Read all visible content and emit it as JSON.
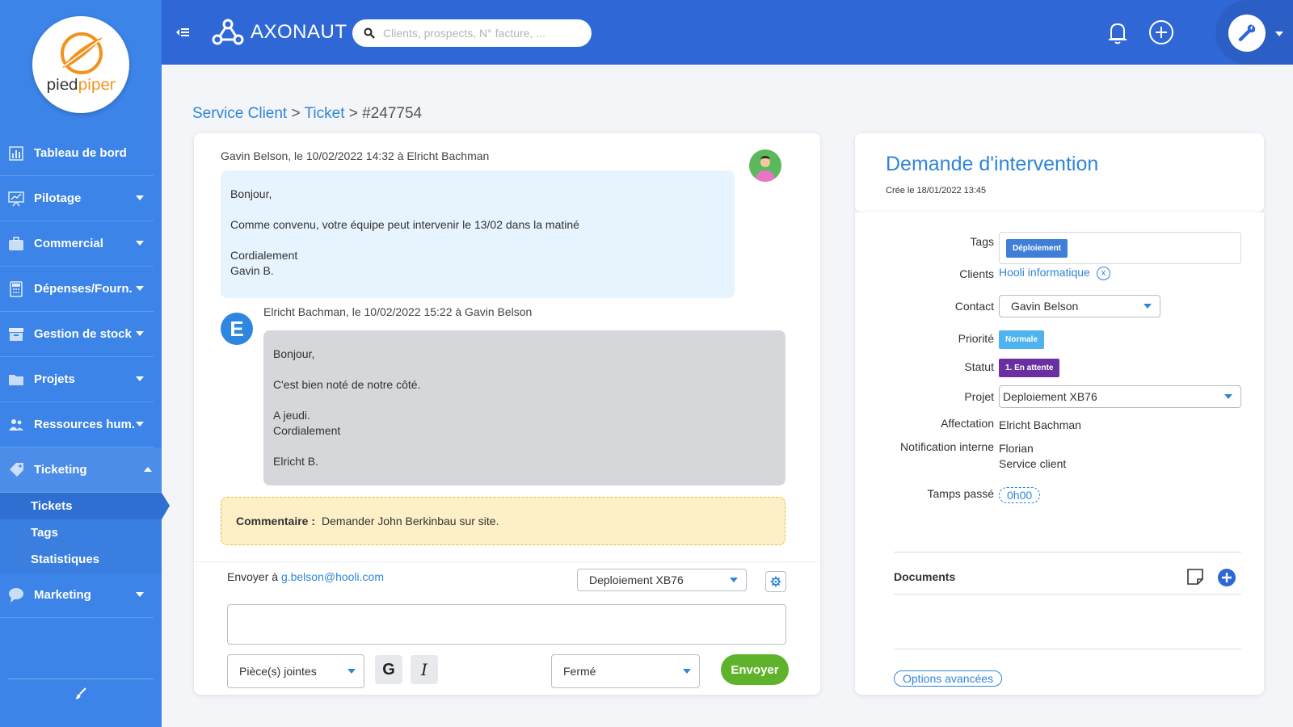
{
  "sidebar": {
    "logo": {
      "text_a": "pied",
      "text_b": "piper"
    },
    "items": [
      {
        "label": "Tableau de bord"
      },
      {
        "label": "Pilotage"
      },
      {
        "label": "Commercial"
      },
      {
        "label": "Dépenses/Fourn."
      },
      {
        "label": "Gestion de stock"
      },
      {
        "label": "Projets"
      },
      {
        "label": "Ressources hum."
      },
      {
        "label": "Ticketing"
      },
      {
        "label": "Marketing"
      }
    ],
    "ticketing_sub": [
      {
        "label": "Tickets"
      },
      {
        "label": "Tags"
      },
      {
        "label": "Statistiques"
      }
    ]
  },
  "topbar": {
    "brand": "AXONAUT",
    "search_placeholder": "Clients, prospects, N° facture, ..."
  },
  "breadcrumb": {
    "part1": "Service Client",
    "sep1": " > ",
    "part2": "Ticket",
    "sep2": " > ",
    "part3": "#247754"
  },
  "conversation": {
    "msg1": {
      "header": "Gavin Belson, le 10/02/2022 14:32 à Elricht Bachman",
      "line1": "Bonjour,",
      "line2": "Comme convenu, votre équipe peut intervenir le 13/02 dans la matiné",
      "line3": "Cordialement",
      "line4": "Gavin B."
    },
    "msg2": {
      "avatar_letter": "E",
      "header": "Elricht Bachman, le 10/02/2022 15:22 à Gavin Belson",
      "line1": "Bonjour,",
      "line2": "C'est bien noté de notre côté.",
      "line3": "A jeudi.",
      "line4": "Cordialement",
      "line5": "Elricht B."
    },
    "comment": {
      "label": "Commentaire :",
      "text": "Demander  John Berkinbau sur site."
    },
    "reply": {
      "send_to_label": "Envoyer à",
      "send_to_email": "g.belson@hooli.com",
      "project_select": "Deploiement XB76",
      "attachments_select": "Pièce(s) jointes",
      "bold_label": "G",
      "italic_label": "I",
      "status_select": "Fermé",
      "send_button": "Envoyer"
    }
  },
  "ticket": {
    "title": "Demande d'intervention",
    "created": "Crée le 18/01/2022 13:45",
    "fields": {
      "tags_label": "Tags",
      "tag_value": "Déploiement",
      "clients_label": "Clients",
      "client_value": "Hooli informatique",
      "client_remove": "x",
      "contact_label": "Contact",
      "contact_value": "Gavin Belson",
      "priority_label": "Priorité",
      "priority_value": "Normale",
      "status_label": "Statut",
      "status_value": "1. En attente",
      "project_label": "Projet",
      "project_value": "Deploiement XB76",
      "assignment_label": "Affectation",
      "assignment_value": "Elricht Bachman",
      "notification_label": "Notification interne",
      "notification_value1": "Florian",
      "notification_value2": "Service client",
      "time_label": "Tamps passé",
      "time_value": "0h00"
    },
    "documents_title": "Documents",
    "advanced_options": "Options avancées"
  },
  "colors": {
    "sidebar_bg": "#3c84e8",
    "topbar_bg": "#2f68d6",
    "link": "#2f86d8",
    "tag_deploiement": "#3f7fd8",
    "priority_normale": "#4fb3f0",
    "status_en_attente": "#6a2fa0",
    "send_button": "#5fb32a"
  }
}
